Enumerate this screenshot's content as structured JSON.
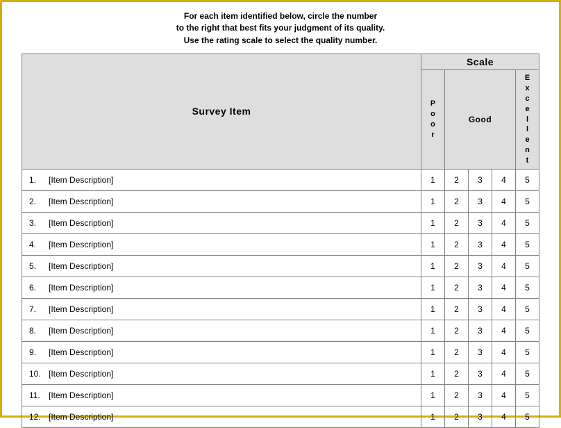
{
  "instructions": {
    "line1": "For each item identified below, circle the number",
    "line2": "to the right that best fits your judgment of its quality.",
    "line3": "Use the rating scale to select the quality number."
  },
  "headers": {
    "survey_item": "Survey Item",
    "scale": "Scale",
    "poor": "Poor",
    "good": "Good",
    "excellent": "Excellent"
  },
  "ratings": [
    "1",
    "2",
    "3",
    "4",
    "5"
  ],
  "items": [
    {
      "n": "1.",
      "desc": "[Item Description]"
    },
    {
      "n": "2.",
      "desc": "[Item Description]"
    },
    {
      "n": "3.",
      "desc": "[Item Description]"
    },
    {
      "n": "4.",
      "desc": "[Item Description]"
    },
    {
      "n": "5.",
      "desc": "[Item Description]"
    },
    {
      "n": "6.",
      "desc": "[Item Description]"
    },
    {
      "n": "7.",
      "desc": "[Item Description]"
    },
    {
      "n": "8.",
      "desc": "[Item Description]"
    },
    {
      "n": "9.",
      "desc": "[Item Description]"
    },
    {
      "n": "10.",
      "desc": "[Item Description]"
    },
    {
      "n": "11.",
      "desc": "[Item Description]"
    },
    {
      "n": "12.",
      "desc": "[Item Description]"
    }
  ]
}
